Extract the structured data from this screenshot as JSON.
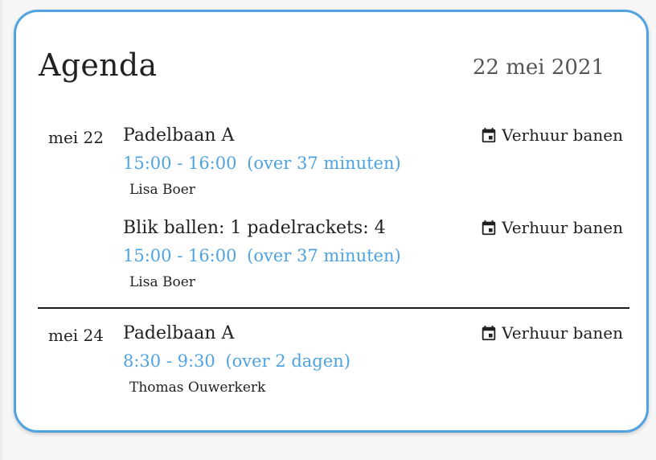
{
  "header": {
    "title": "Agenda",
    "date": "22 mei 2021"
  },
  "days": [
    {
      "label": "mei 22",
      "events": [
        {
          "title": "Padelbaan A",
          "time": "15:00 - 16:00",
          "relative": "(over 37 minuten)",
          "person": "Lisa Boer",
          "calendar": "Verhuur banen",
          "calendar_icon": "calendar-icon"
        },
        {
          "title": "Blik ballen: 1 padelrackets: 4",
          "time": "15:00 - 16:00",
          "relative": "(over 37 minuten)",
          "person": "Lisa Boer",
          "calendar": "Verhuur banen",
          "calendar_icon": "calendar-icon"
        }
      ]
    },
    {
      "label": "mei 24",
      "events": [
        {
          "title": "Padelbaan A",
          "time": "8:30 - 9:30",
          "relative": "(over 2 dagen)",
          "person": "Thomas Ouwerkerk",
          "calendar": "Verhuur banen",
          "calendar_icon": "calendar-icon"
        }
      ]
    }
  ],
  "colors": {
    "accent": "#4fa3e0",
    "text": "#212121",
    "muted": "#555555",
    "card_border": "#4fa3e0"
  }
}
